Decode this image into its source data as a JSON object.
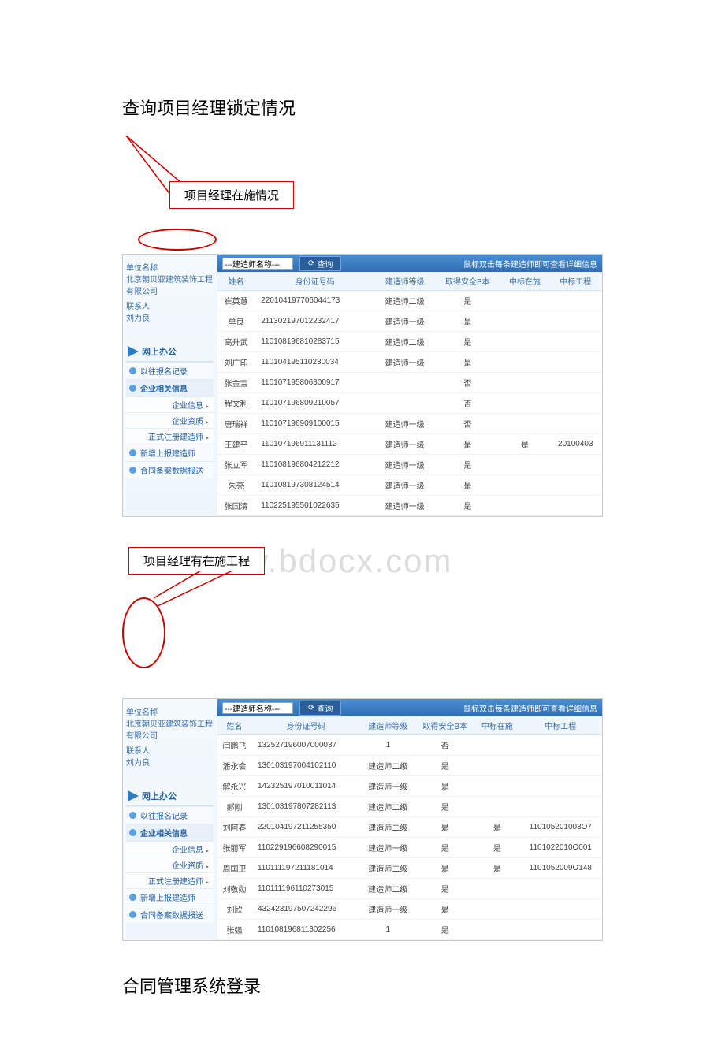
{
  "heading1": "查询项目经理锁定情况",
  "callout1": "项目经理在施情况",
  "callout2": "项目经理有在施工程",
  "heading2": "合同管理系统登录",
  "watermark": "www.bdocx.com",
  "sidebar": {
    "label_unit": "单位名称",
    "company": "北京朝贝亚建筑装饰工程有限公司",
    "label_contact": "联系人",
    "contact": "刘为良",
    "nav_head": "网上办公",
    "items": {
      "history": "以往报名记录",
      "corp": "企业相关信息",
      "corp_info": "企业信息",
      "corp_qual": "企业资质",
      "reg_builder": "正式注册建造师",
      "add_builder": "新增上报建造师",
      "backup": "合同备案数据报送"
    }
  },
  "topbar": {
    "input": "---建造师名称---",
    "query": "查询",
    "hint": "鼠标双击每条建造师即可查看详细信息"
  },
  "columns": {
    "name": "姓名",
    "id": "身份证号码",
    "level": "建造师等级",
    "safety": "取得安全B本",
    "ongoing": "中标在施",
    "project": "中标工程"
  },
  "table1": [
    {
      "name": "崔英慧",
      "id": "220104197706044173",
      "level": "建造师二级",
      "safety": "是",
      "ongoing": "",
      "project": ""
    },
    {
      "name": "单良",
      "id": "211302197012232417",
      "level": "建造师一级",
      "safety": "是",
      "ongoing": "",
      "project": ""
    },
    {
      "name": "高升武",
      "id": "110108196810283715",
      "level": "建造师二级",
      "safety": "是",
      "ongoing": "",
      "project": ""
    },
    {
      "name": "刘广印",
      "id": "110104195110230034",
      "level": "建造师一级",
      "safety": "是",
      "ongoing": "",
      "project": ""
    },
    {
      "name": "张金宝",
      "id": "110107195806300917",
      "level": "",
      "safety": "否",
      "ongoing": "",
      "project": ""
    },
    {
      "name": "程文利",
      "id": "110107196809210057",
      "level": "",
      "safety": "否",
      "ongoing": "",
      "project": ""
    },
    {
      "name": "唐瑞祥",
      "id": "110107196909100015",
      "level": "建造师一级",
      "safety": "否",
      "ongoing": "",
      "project": ""
    },
    {
      "name": "王建平",
      "id": "110107196911131112",
      "level": "建造师一级",
      "safety": "是",
      "ongoing": "是",
      "project": "20100403"
    },
    {
      "name": "张立军",
      "id": "110108196804212212",
      "level": "建造师一级",
      "safety": "是",
      "ongoing": "",
      "project": ""
    },
    {
      "name": "朱亮",
      "id": "110108197308124514",
      "level": "建造师一级",
      "safety": "是",
      "ongoing": "",
      "project": ""
    },
    {
      "name": "张国清",
      "id": "110225195501022635",
      "level": "建造师一级",
      "safety": "是",
      "ongoing": "",
      "project": ""
    }
  ],
  "table2": [
    {
      "name": "闫鹏飞",
      "id": "132527196007000037",
      "level": "1",
      "safety": "否",
      "ongoing": "",
      "project": ""
    },
    {
      "name": "潘永会",
      "id": "130103197004102110",
      "level": "建造师二级",
      "safety": "是",
      "ongoing": "",
      "project": ""
    },
    {
      "name": "解永兴",
      "id": "142325197010011014",
      "level": "建造师一级",
      "safety": "是",
      "ongoing": "",
      "project": ""
    },
    {
      "name": "郝刚",
      "id": "130103197807282113",
      "level": "建造师二级",
      "safety": "是",
      "ongoing": "",
      "project": ""
    },
    {
      "name": "刘阿春",
      "id": "220104197211255350",
      "level": "建造师二级",
      "safety": "是",
      "ongoing": "是",
      "project": "110105201003O7"
    },
    {
      "name": "张丽军",
      "id": "110229196608290015",
      "level": "建造师一级",
      "safety": "是",
      "ongoing": "是",
      "project": "1101022010O001"
    },
    {
      "name": "周国卫",
      "id": "110111197211181014",
      "level": "建造师二级",
      "safety": "是",
      "ongoing": "是",
      "project": "1101052009O148"
    },
    {
      "name": "刘敬勋",
      "id": "110111196110273015",
      "level": "建造师二级",
      "safety": "是",
      "ongoing": "",
      "project": ""
    },
    {
      "name": "刘欣",
      "id": "432423197507242296",
      "level": "建造师一级",
      "safety": "是",
      "ongoing": "",
      "project": ""
    },
    {
      "name": "张强",
      "id": "110108196811302256",
      "level": "1",
      "safety": "是",
      "ongoing": "",
      "project": ""
    }
  ]
}
